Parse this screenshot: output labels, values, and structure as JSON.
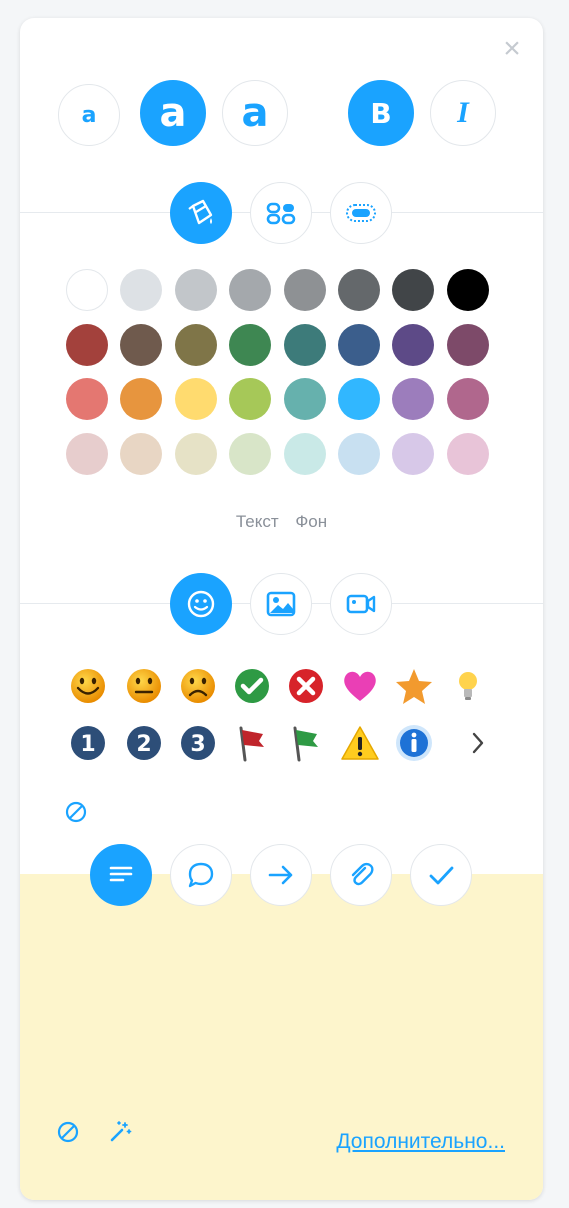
{
  "toolbar": {
    "close_label": "×",
    "font_sizes": [
      "a",
      "a",
      "a"
    ],
    "bold_label": "B",
    "italic_label": "I"
  },
  "color_section": {
    "tabs": [
      "Текст",
      "Фон"
    ],
    "colors": [
      [
        "#ffffff",
        "#dde1e5",
        "#c2c6ca",
        "#a4a8ac",
        "#8e9194",
        "#64686b",
        "#414548",
        "#000000"
      ],
      [
        "#a3413c",
        "#6f5a4d",
        "#7f7548",
        "#3e8752",
        "#3d7b7a",
        "#3b5e8c",
        "#5d4a87",
        "#7d4a69"
      ],
      [
        "#e47771",
        "#e7953e",
        "#ffdb6f",
        "#a6c858",
        "#66b1ad",
        "#31b7ff",
        "#9c7dbc",
        "#b0678d"
      ],
      [
        "#e7cdcd",
        "#e8d6c4",
        "#e6e2c6",
        "#d8e5c8",
        "#c9e9e7",
        "#c8e0f1",
        "#d7c8e8",
        "#e8c4d8"
      ]
    ]
  },
  "icon_tools": {
    "accent": "#1aa3ff"
  },
  "footer": {
    "more_label": "Дополнительно..."
  }
}
